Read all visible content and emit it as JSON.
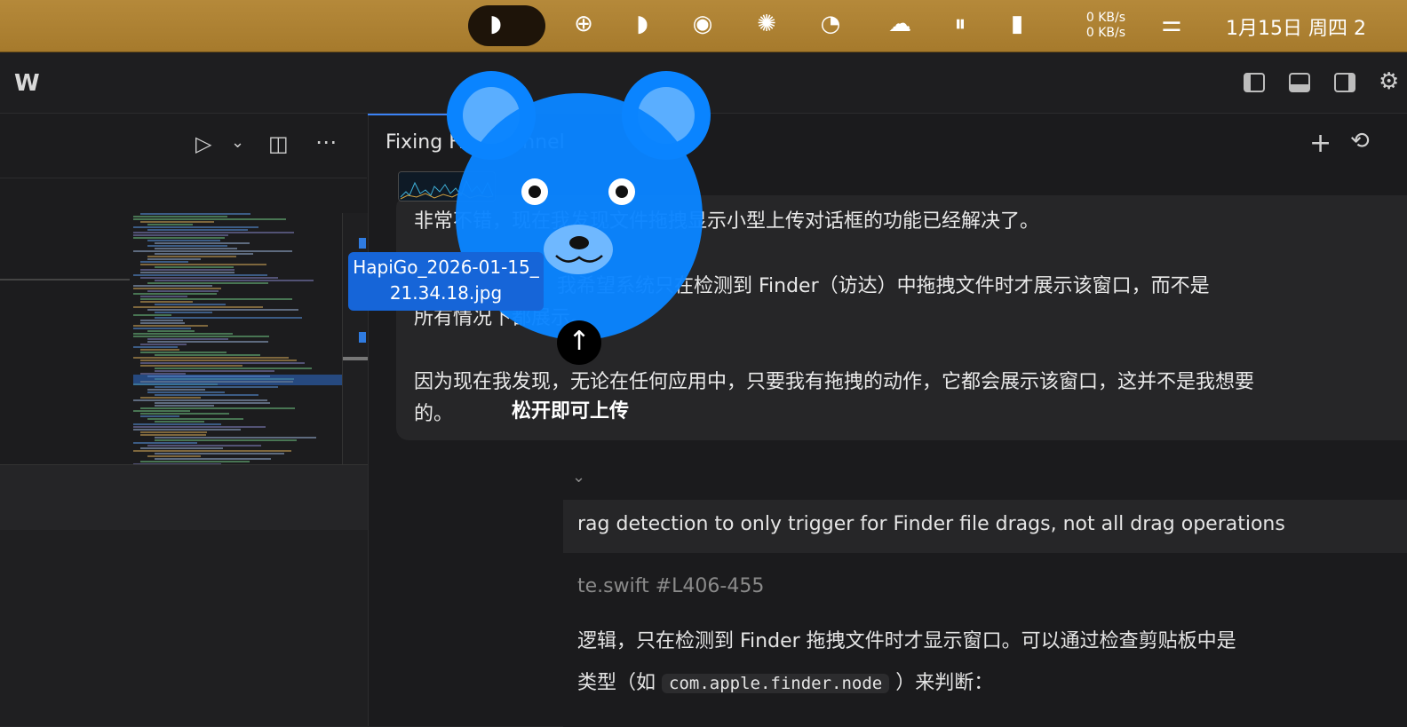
{
  "menubar": {
    "net_up": "0 KB/s",
    "net_down": "0 KB/s",
    "datetime": "1月15日 周四 2"
  },
  "chat": {
    "title": "Fixing Fi        r Channel",
    "user_message_lines": [
      "非常不错，现在我发现文件拖拽显示小型上传对话框的功能已经解决了。",
      "但目前  个问题：我希望系统只在检测到 Finder（访达）中拖拽文件时才展示该窗口，而不是",
      "所有情况下都展示。",
      "因为现在我发现，无论在任何应用中，只要我有拖拽的动作，它都会展示该窗口，这并不是我想要",
      "的。"
    ],
    "response_summary": "rag detection to only trigger for Finder file drags, not all drag operations",
    "response_file_ref": "te.swift #L406-455",
    "response_line1": "逻辑，只在检测到 Finder 拖拽文件时才显示窗口。可以通过检查剪贴板中是",
    "response_line2_pre": "类型（如",
    "response_code": "com.apple.finder.node",
    "response_line2_post": "）来判断："
  },
  "drag_overlay": {
    "file_name": "HapiGo_2026-01-15_21.34.18.jpg",
    "drop_hint": "松开即可上传"
  },
  "colors": {
    "menubar_bg": "#b5893a",
    "accent": "#0a84ff",
    "panel_bg": "#1b1b1d"
  }
}
